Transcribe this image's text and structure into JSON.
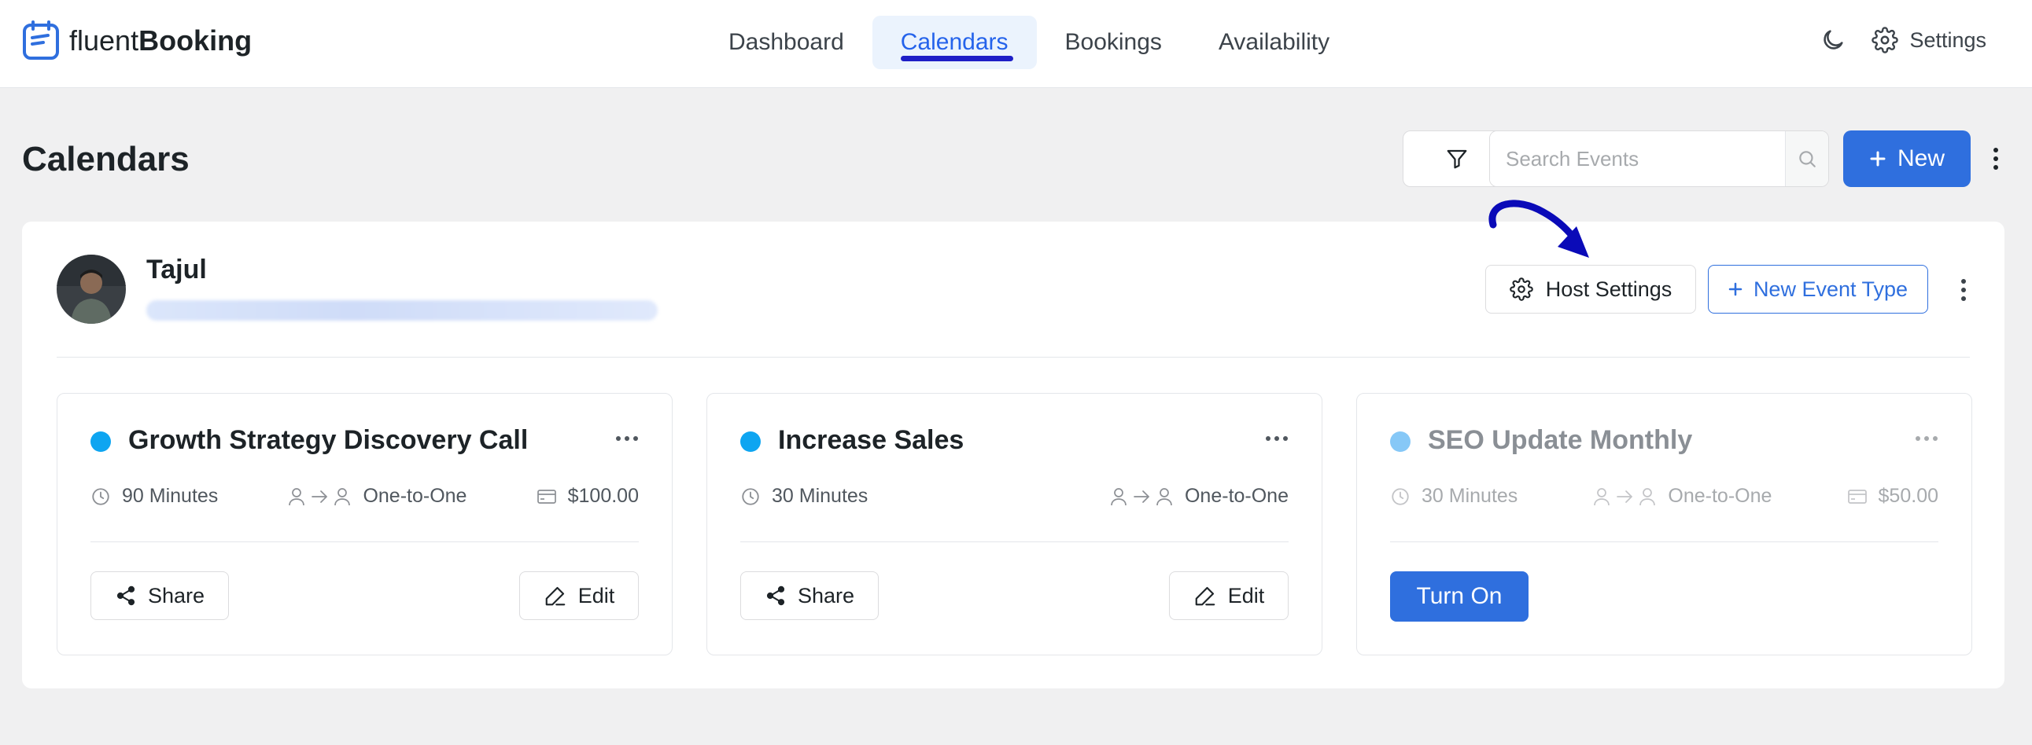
{
  "app": {
    "logo_light": "fluent",
    "logo_bold": "Booking"
  },
  "nav": {
    "items": [
      {
        "label": "Dashboard",
        "active": false
      },
      {
        "label": "Calendars",
        "active": true
      },
      {
        "label": "Bookings",
        "active": false
      },
      {
        "label": "Availability",
        "active": false
      }
    ],
    "theme_icon": "moon-icon",
    "settings_label": "Settings"
  },
  "page": {
    "title": "Calendars",
    "search_placeholder": "Search Events",
    "new_label": "New"
  },
  "host": {
    "name": "Tajul",
    "host_settings_label": "Host Settings",
    "new_event_type_label": "New Event Type"
  },
  "events": [
    {
      "title": "Growth Strategy Discovery Call",
      "dot_color": "#0ea5f1",
      "duration": "90 Minutes",
      "type": "One-to-One",
      "price": "$100.00",
      "share_label": "Share",
      "edit_label": "Edit"
    },
    {
      "title": "Increase Sales",
      "dot_color": "#0ea5f1",
      "duration": "30 Minutes",
      "type": "One-to-One",
      "share_label": "Share",
      "edit_label": "Edit"
    },
    {
      "title": "SEO Update Monthly",
      "dot_color": "#86c8f7",
      "duration": "30 Minutes",
      "type": "One-to-One",
      "price": "$50.00",
      "turn_on_label": "Turn On"
    }
  ],
  "colors": {
    "primary": "#2f6fde",
    "active_underline": "#1e1ec7",
    "annotation_arrow": "#0a0ab8"
  }
}
